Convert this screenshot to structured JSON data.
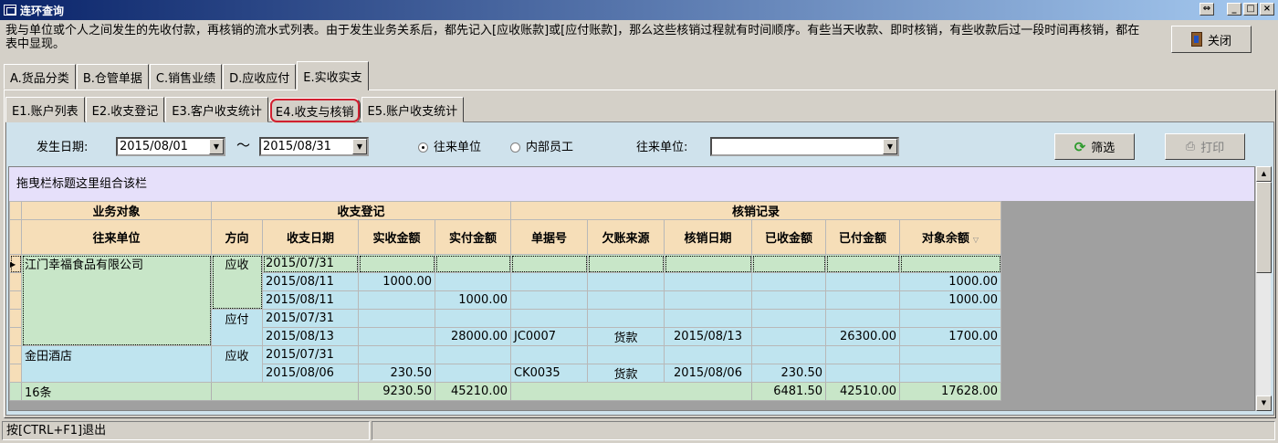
{
  "window": {
    "title": "连环查询",
    "restore_label": "⇔",
    "min_label": "_",
    "max_label": "□",
    "close_label": "×"
  },
  "description": "我与单位或个人之间发生的先收付款，再核销的流水式列表。由于发生业务关系后，都先记入[应收账款]或[应付账款]，那么这些核销过程就有时间顺序。有些当天收款、即时核销，有些收款后过一段时间再核销，都在表中显现。",
  "close_button": "关闭",
  "main_tabs": [
    "A.货品分类",
    "B.仓管单据",
    "C.销售业绩",
    "D.应收应付",
    "E.实收实支"
  ],
  "sub_tabs": [
    "E1.账户列表",
    "E2.收支登记",
    "E3.客户收支统计",
    "E4.收支与核销",
    "E5.账户收支统计"
  ],
  "filter": {
    "date_label": "发生日期:",
    "date_from": "2015/08/01",
    "tilde": "～",
    "date_to": "2015/08/31",
    "radio_partner": "往来单位",
    "radio_staff": "内部员工",
    "partner_label": "往来单位:",
    "partner_value": ""
  },
  "filter_button": "筛选",
  "print_button": "打印",
  "group_bar": "拖曳栏标题这里组合该栏",
  "table": {
    "band_object": "业务对象",
    "band_register": "收支登记",
    "band_writeoff": "核销记录",
    "columns": [
      "往来单位",
      "方向",
      "收支日期",
      "实收金额",
      "实付金额",
      "单据号",
      "欠账来源",
      "核销日期",
      "已收金额",
      "已付金额",
      "对象余额"
    ],
    "rows": [
      {
        "unit": "江门幸福食品有限公司",
        "dir": "应收",
        "date": "2015/07/31",
        "recv": "",
        "paid": "",
        "bill": "",
        "src": "",
        "wdate": "",
        "wrecv": "",
        "wpaid": "",
        "bal": ""
      },
      {
        "unit": "",
        "dir": "",
        "date": "2015/08/11",
        "recv": "1000.00",
        "paid": "",
        "bill": "",
        "src": "",
        "wdate": "",
        "wrecv": "",
        "wpaid": "",
        "bal": "1000.00"
      },
      {
        "unit": "",
        "dir": "",
        "date": "2015/08/11",
        "recv": "",
        "paid": "1000.00",
        "bill": "",
        "src": "",
        "wdate": "",
        "wrecv": "",
        "wpaid": "",
        "bal": "1000.00"
      },
      {
        "unit": "",
        "dir": "应付",
        "date": "2015/07/31",
        "recv": "",
        "paid": "",
        "bill": "",
        "src": "",
        "wdate": "",
        "wrecv": "",
        "wpaid": "",
        "bal": ""
      },
      {
        "unit": "",
        "dir": "",
        "date": "2015/08/13",
        "recv": "",
        "paid": "28000.00",
        "bill": "JC0007",
        "src": "货款",
        "wdate": "2015/08/13",
        "wrecv": "",
        "wpaid": "26300.00",
        "bal": "1700.00"
      },
      {
        "unit": "金田酒店",
        "dir": "应收",
        "date": "2015/07/31",
        "recv": "",
        "paid": "",
        "bill": "",
        "src": "",
        "wdate": "",
        "wrecv": "",
        "wpaid": "",
        "bal": ""
      },
      {
        "unit": "",
        "dir": "",
        "date": "2015/08/06",
        "recv": "230.50",
        "paid": "",
        "bill": "CK0035",
        "src": "货款",
        "wdate": "2015/08/06",
        "wrecv": "230.50",
        "wpaid": "",
        "bal": ""
      }
    ],
    "footer": {
      "count": "16条",
      "recv": "9230.50",
      "paid": "45210.00",
      "wrecv": "6481.50",
      "wpaid": "42510.00",
      "bal": "17628.00"
    }
  },
  "status": {
    "hint": "按[CTRL+F1]退出"
  }
}
